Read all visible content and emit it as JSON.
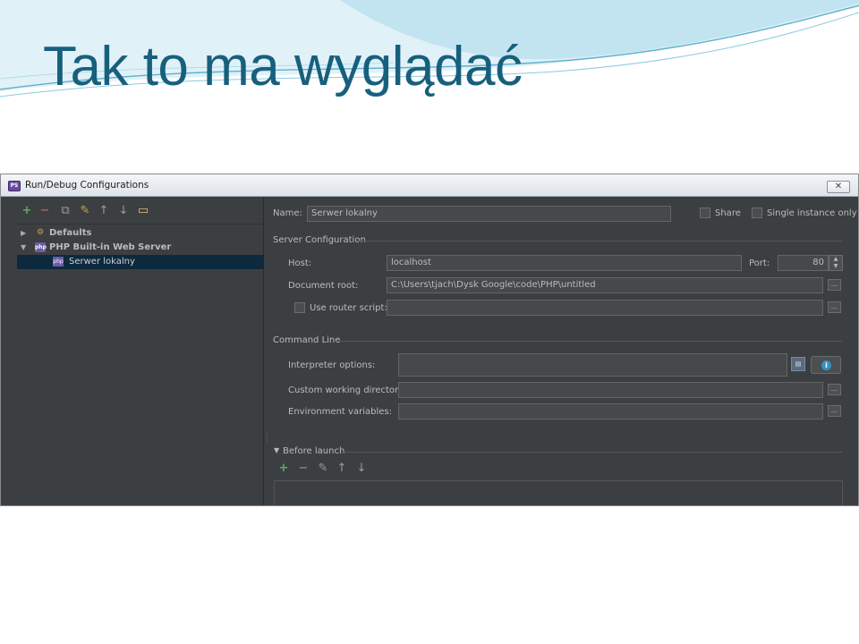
{
  "slide": {
    "title": "Tak to ma wyglądać",
    "title_color": "#17607d"
  },
  "dialog": {
    "title": "Run/Debug Configurations",
    "close_glyph": "✕",
    "icon": "phpstorm-icon"
  },
  "left_toolbar": {
    "icons": [
      "add-icon",
      "remove-icon",
      "copy-icon",
      "edit-defaults-icon",
      "move-up-icon",
      "move-down-icon",
      "folder-icon"
    ],
    "add": "+",
    "remove": "−",
    "copy": "⧉",
    "edit": "✎",
    "up": "↑",
    "down": "↓",
    "folder": "▭"
  },
  "tree": {
    "defaults": "Defaults",
    "php_server": "PHP Built-in Web Server",
    "selected_item": "Serwer lokalny"
  },
  "form": {
    "name_label": "Name:",
    "name_value": "Serwer lokalny",
    "share_label": "Share",
    "single_instance_label": "Single instance only",
    "server_config_title": "Server Configuration",
    "host_label": "Host:",
    "host_value": "localhost",
    "port_label": "Port:",
    "port_value": "80",
    "docroot_label": "Document root:",
    "docroot_value": "C:\\Users\\tjach\\Dysk Google\\code\\PHP\\untitled",
    "router_label": "Use router script:",
    "router_value": "",
    "command_line_title": "Command Line",
    "interp_label": "Interpreter options:",
    "interp_value": "",
    "cwd_label": "Custom working directory:",
    "cwd_value": "",
    "env_label": "Environment variables:",
    "env_value": "",
    "before_launch_title": "Before launch",
    "browse_glyph": "...",
    "info_glyph": "i",
    "expand_glyph": "▤"
  },
  "colors": {
    "panel_bg": "#3c3f41",
    "field_bg": "#45494a",
    "selection": "#0d293e",
    "add_green": "#59a869",
    "remove_red": "#c75450"
  }
}
